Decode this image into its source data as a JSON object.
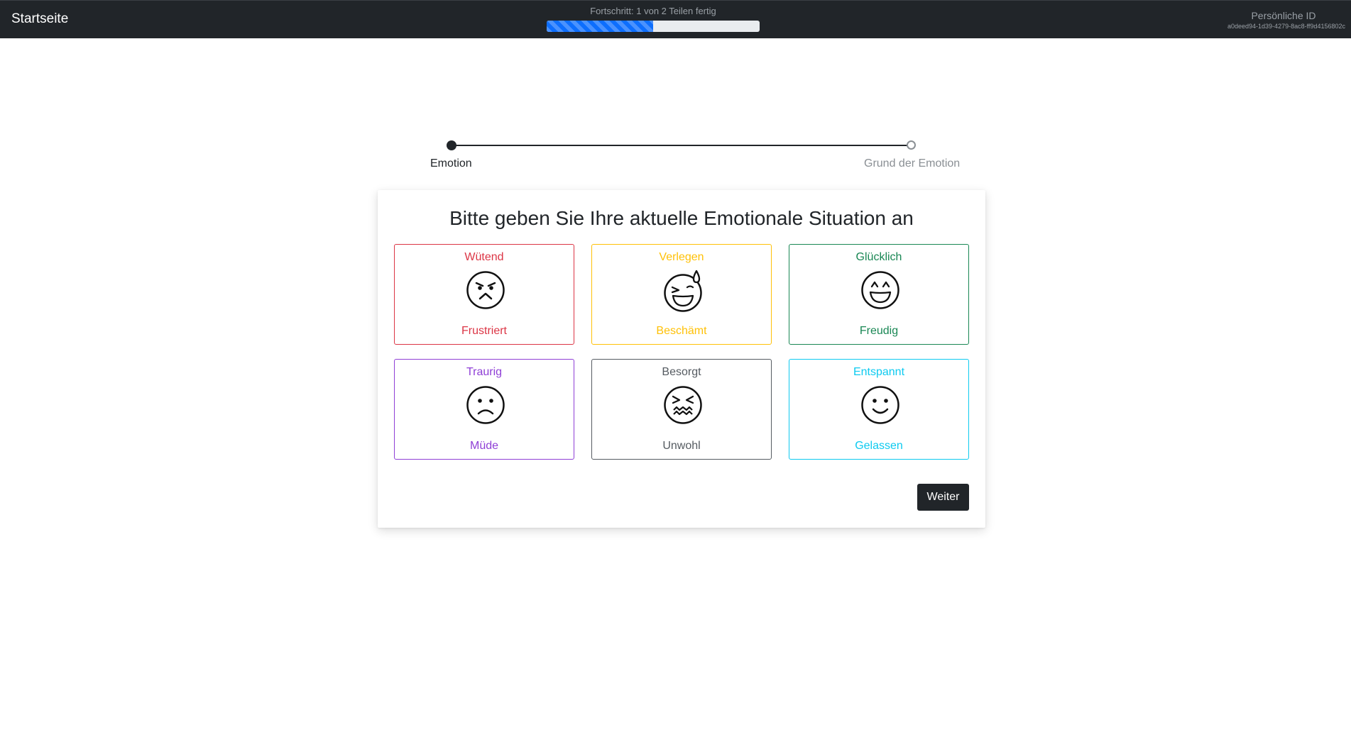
{
  "navbar": {
    "brand": "Startseite",
    "progress_label": "Fortschritt: 1 von 2 Teilen fertig",
    "progress_fraction": 0.5,
    "progress_color": "#0d6efd",
    "personal_id_label": "Persönliche ID",
    "personal_id_value": "a0deed94-1d39-4279-8ac8-ff9d4156802c"
  },
  "stepper": {
    "steps": [
      {
        "label": "Emotion",
        "state": "active"
      },
      {
        "label": "Grund der Emotion",
        "state": "inactive"
      }
    ]
  },
  "card": {
    "title": "Bitte geben Sie Ihre aktuelle Emotionale Situation an",
    "tiles": [
      {
        "top": "Wütend",
        "bottom": "Frustriert",
        "color": "#dc3545",
        "icon": "angry-face-icon"
      },
      {
        "top": "Verlegen",
        "bottom": "Beschämt",
        "color": "#ffc107",
        "icon": "sweat-smile-face-icon"
      },
      {
        "top": "Glücklich",
        "bottom": "Freudig",
        "color": "#198754",
        "icon": "grin-face-icon"
      },
      {
        "top": "Traurig",
        "bottom": "Müde",
        "color": "#8f3fd6",
        "icon": "frown-face-icon"
      },
      {
        "top": "Besorgt",
        "bottom": "Unwohl",
        "color": "#555b61",
        "icon": "confounded-face-icon"
      },
      {
        "top": "Entspannt",
        "bottom": "Gelassen",
        "color": "#0dcaf0",
        "icon": "smile-face-icon"
      }
    ],
    "next_button": "Weiter"
  }
}
